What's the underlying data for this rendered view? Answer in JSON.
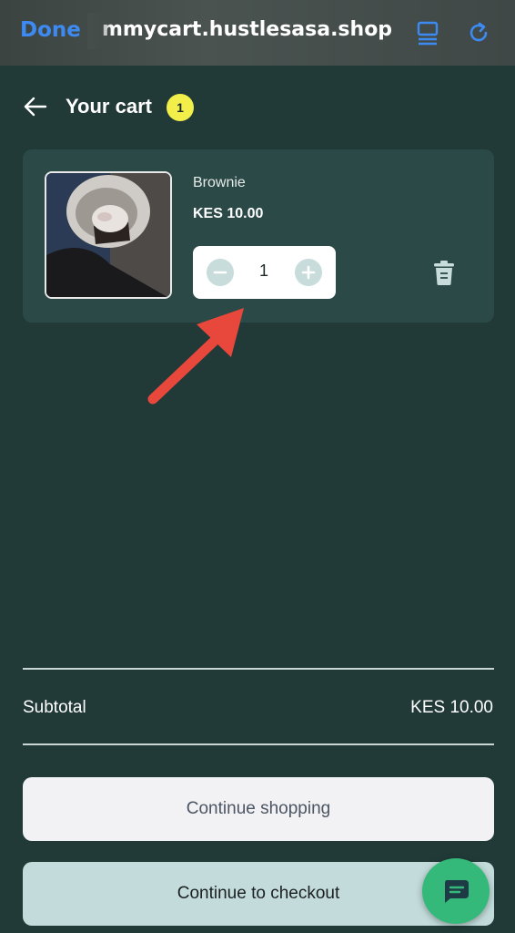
{
  "browser": {
    "done_label": "Done",
    "url": "mmycart.hustlesasa.shop"
  },
  "header": {
    "title": "Your cart",
    "count": "1"
  },
  "cart": {
    "items": [
      {
        "name": "Brownie",
        "price": "KES 10.00",
        "quantity": "1"
      }
    ]
  },
  "summary": {
    "subtotal_label": "Subtotal",
    "subtotal_value": "KES 10.00"
  },
  "actions": {
    "continue_shopping": "Continue shopping",
    "checkout": "Continue to checkout"
  },
  "icons": {
    "back": "arrow-left-icon",
    "tabs": "tabs-icon",
    "reload": "reload-icon",
    "trash": "trash-icon",
    "chat": "chat-icon"
  },
  "colors": {
    "background": "#213a38",
    "card": "#2a4947",
    "badge": "#f2ef4b",
    "link": "#3d8bf2",
    "chat": "#34b97a",
    "annotation": "#e8473b"
  }
}
